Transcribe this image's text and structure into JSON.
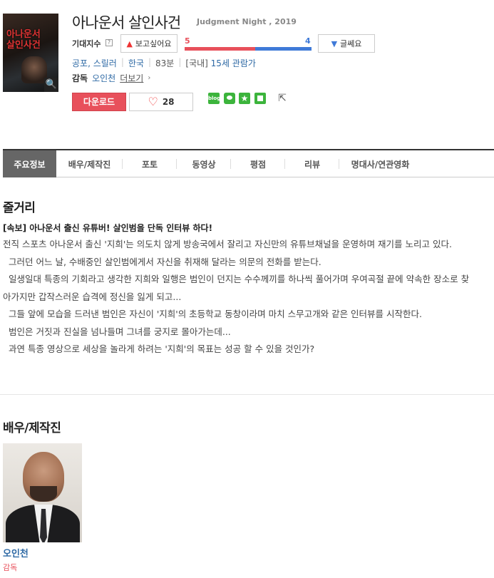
{
  "poster": {
    "title_art": "아나운서 살인사건",
    "zoom_icon": "magnifier-icon"
  },
  "movie": {
    "title": "아나운서 살인사건",
    "subtitle": "Judgment Night , 2019"
  },
  "expectation": {
    "label": "기대지수",
    "help": "?",
    "want_label": "보고싶어요",
    "want_count": "5",
    "meh_label": "글쎄요",
    "meh_count": "4",
    "want_fraction": 0.556
  },
  "meta": {
    "genres": "공포, 스릴러",
    "country": "한국",
    "runtime": "83분",
    "rating_prefix": "[국내]",
    "rating": "15세 관람가"
  },
  "director": {
    "label": "감독",
    "name": "오인천",
    "more": "더보기"
  },
  "actions": {
    "download": "다운로드",
    "like_count": "28",
    "blog_label": "blog"
  },
  "tabs": [
    {
      "label": "주요정보",
      "active": true
    },
    {
      "label": "배우/제작진",
      "active": false
    },
    {
      "label": "포토",
      "active": false
    },
    {
      "label": "동영상",
      "active": false
    },
    {
      "label": "평점",
      "active": false
    },
    {
      "label": "리뷰",
      "active": false
    },
    {
      "label": "명대사/연관영화",
      "active": false
    }
  ],
  "synopsis": {
    "title": "줄거리",
    "headline": "[속보] 아나운서 출신 유튜버! 살인범을 단독 인터뷰 하다!",
    "paragraphs": [
      "전직 스포츠 아나운서 출신 '지희'는 의도치 않게 방송국에서 잘리고 자신만의 유튜브채널을 운영하며 재기를 노리고 있다.",
      "그러던 어느 날, 수배중인 살인범에게서 자신을 취재해 달라는 의문의 전화를 받는다.",
      "일생일대 특종의 기회라고 생각한 지희와 일행은 범인이 던지는 수수께끼를 하나씩 풀어가며 우여곡절 끝에 약속한 장소로 찾아가지만 갑작스러운 습격에 정신을 잃게 되고...",
      "그들 앞에 모습을 드러낸 범인은 자신이 '지희'의 초등학교 동창이라며 마치 스무고개와 같은 인터뷰를 시작한다.",
      "범인은 거짓과 진실을 넘나들며 그녀를 궁지로 몰아가는데...",
      "과연 특종 영상으로 세상을 놀라게 하려는 '지희'의 목표는 성공 할 수 있을 것인가?"
    ]
  },
  "cast": {
    "title": "배우/제작진",
    "members": [
      {
        "name": "오인천",
        "role": "감독"
      }
    ]
  }
}
